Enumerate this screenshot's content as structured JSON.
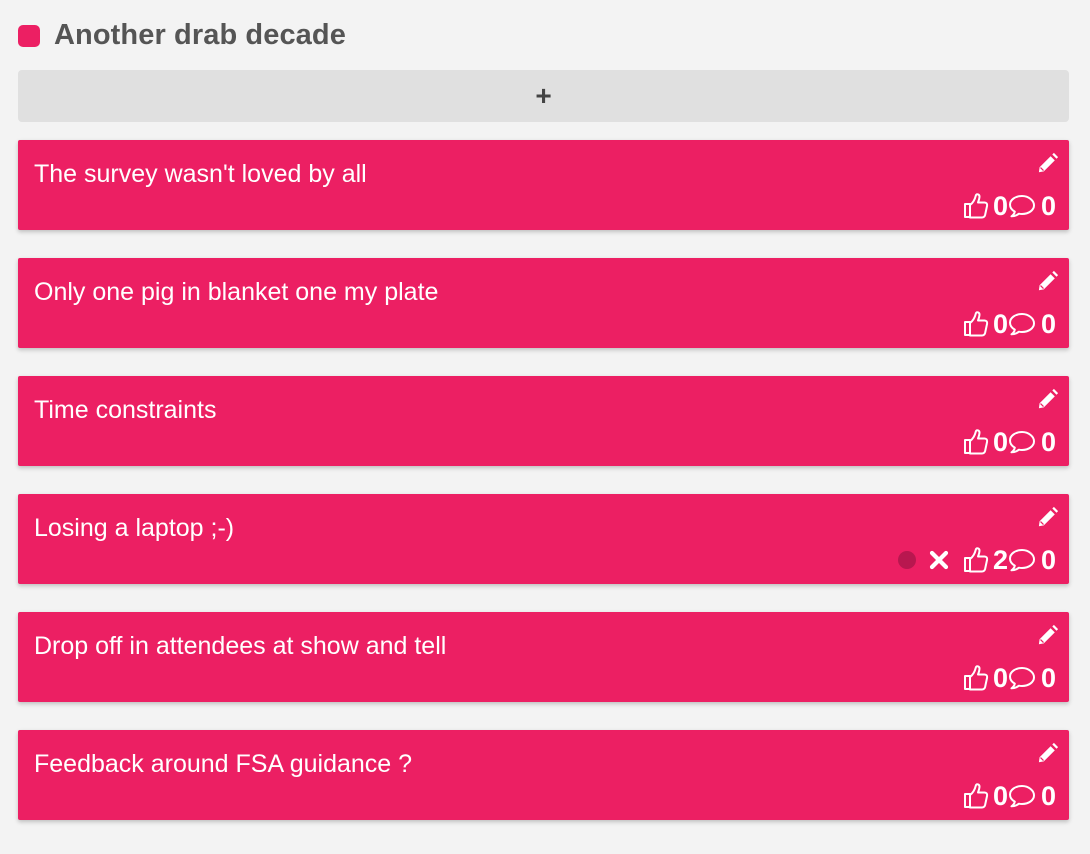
{
  "column": {
    "title": "Another drab decade",
    "color": "#ec1f63",
    "add_label": "+"
  },
  "colors": {
    "card": "#ec1f63",
    "status_dot": "#b8174f"
  },
  "cards": [
    {
      "text": "The survey wasn't loved by all",
      "likes": "0",
      "comments": "0",
      "pending": false
    },
    {
      "text": "Only one pig in blanket one my plate",
      "likes": "0",
      "comments": "0",
      "pending": false
    },
    {
      "text": "Time constraints",
      "likes": "0",
      "comments": "0",
      "pending": false
    },
    {
      "text": "Losing a laptop ;-)",
      "likes": "2",
      "comments": "0",
      "pending": true
    },
    {
      "text": "Drop off in attendees at show and tell",
      "likes": "0",
      "comments": "0",
      "pending": false
    },
    {
      "text": "Feedback around FSA guidance ?",
      "likes": "0",
      "comments": "0",
      "pending": false
    }
  ],
  "icons": {
    "edit": "pencil-icon",
    "like": "thumbs-up-icon",
    "comment": "comment-bubble-icon",
    "remove": "close-icon"
  }
}
